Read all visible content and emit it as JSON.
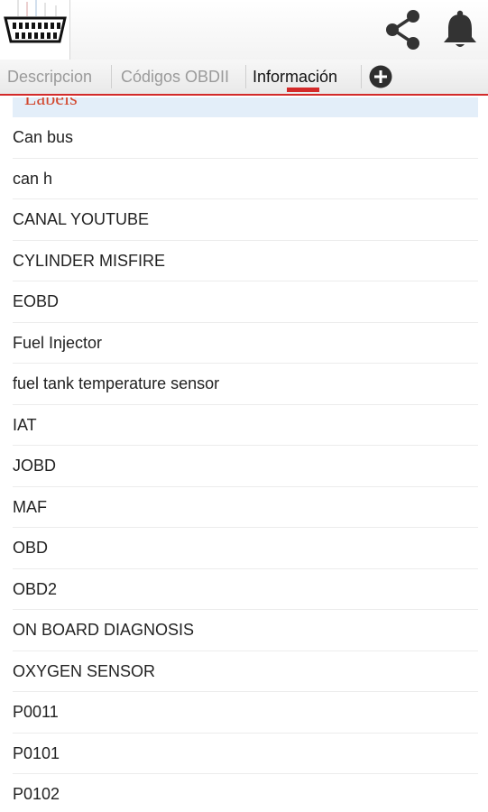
{
  "header": {
    "logo_icon": "obd-connector-icon",
    "actions": [
      {
        "icon": "share-icon"
      },
      {
        "icon": "bell-icon"
      }
    ]
  },
  "tabs": [
    {
      "label": "Descripcion",
      "active": false
    },
    {
      "label": "Códigos OBDII",
      "active": false
    },
    {
      "label": "Información",
      "active": true
    }
  ],
  "add_tab_icon": "plus-circle-icon",
  "accent_color": "#d32a2a",
  "section": {
    "title": "Labels"
  },
  "labels": [
    "Can bus",
    "can h",
    "CANAL YOUTUBE",
    "CYLINDER MISFIRE",
    "EOBD",
    "Fuel Injector",
    "fuel tank temperature sensor",
    "IAT",
    "JOBD",
    "MAF",
    "OBD",
    "OBD2",
    "ON BOARD DIAGNOSIS",
    "OXYGEN SENSOR",
    "P0011",
    "P0101",
    "P0102"
  ]
}
